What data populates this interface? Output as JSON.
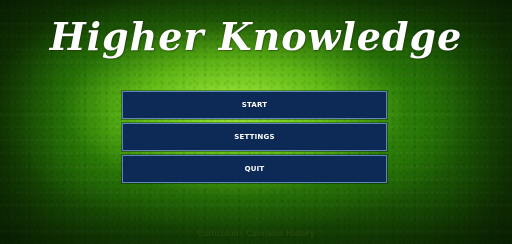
{
  "title": "Higher Knowledge",
  "menu": {
    "start_label": "START",
    "settings_label": "SETTINGS",
    "quit_label": "QUIT"
  },
  "footer": {
    "curriculum_text": "Curriculum: Cannabis History"
  },
  "colors": {
    "button_fill": "#0d2a57",
    "button_border": "#5b86c0",
    "background_center": "#a5f03c",
    "background_edge": "#0e2f02"
  }
}
